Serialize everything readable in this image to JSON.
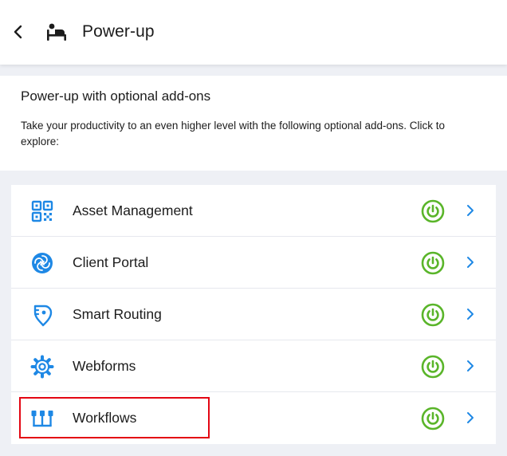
{
  "header": {
    "title": "Power-up",
    "back_icon": "chevron-left-icon",
    "title_icon": "massage-bed-icon"
  },
  "intro": {
    "title": "Power-up with optional add-ons",
    "description": "Take your productivity to an even higher level with the following optional add-ons. Click to explore:"
  },
  "addons": [
    {
      "label": "Asset Management",
      "icon": "qr-code-icon",
      "enabled": true
    },
    {
      "label": "Client Portal",
      "icon": "portal-swirl-icon",
      "enabled": true
    },
    {
      "label": "Smart Routing",
      "icon": "map-pin-icon",
      "enabled": true
    },
    {
      "label": "Webforms",
      "icon": "gear-icon",
      "enabled": true
    },
    {
      "label": "Workflows",
      "icon": "workflow-icon",
      "enabled": true
    }
  ],
  "colors": {
    "accent_blue": "#1e88e5",
    "power_green": "#5ab52a",
    "highlight_red": "#e30613",
    "background": "#eef0f5"
  }
}
